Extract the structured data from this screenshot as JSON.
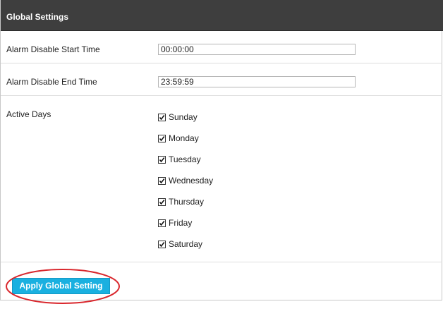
{
  "header": {
    "title": "Global Settings"
  },
  "fields": {
    "start_time": {
      "label": "Alarm Disable Start Time",
      "value": "00:00:00"
    },
    "end_time": {
      "label": "Alarm Disable End Time",
      "value": "23:59:59"
    }
  },
  "active_days": {
    "label": "Active Days",
    "days": [
      {
        "label": "Sunday",
        "checked": true
      },
      {
        "label": "Monday",
        "checked": true
      },
      {
        "label": "Tuesday",
        "checked": true
      },
      {
        "label": "Wednesday",
        "checked": true
      },
      {
        "label": "Thursday",
        "checked": true
      },
      {
        "label": "Friday",
        "checked": true
      },
      {
        "label": "Saturday",
        "checked": true
      }
    ]
  },
  "apply_button": {
    "label": "Apply Global Setting"
  },
  "colors": {
    "header_bg": "#3e3e3e",
    "button_bg": "#1ab0e0",
    "highlight": "#d9262c"
  }
}
